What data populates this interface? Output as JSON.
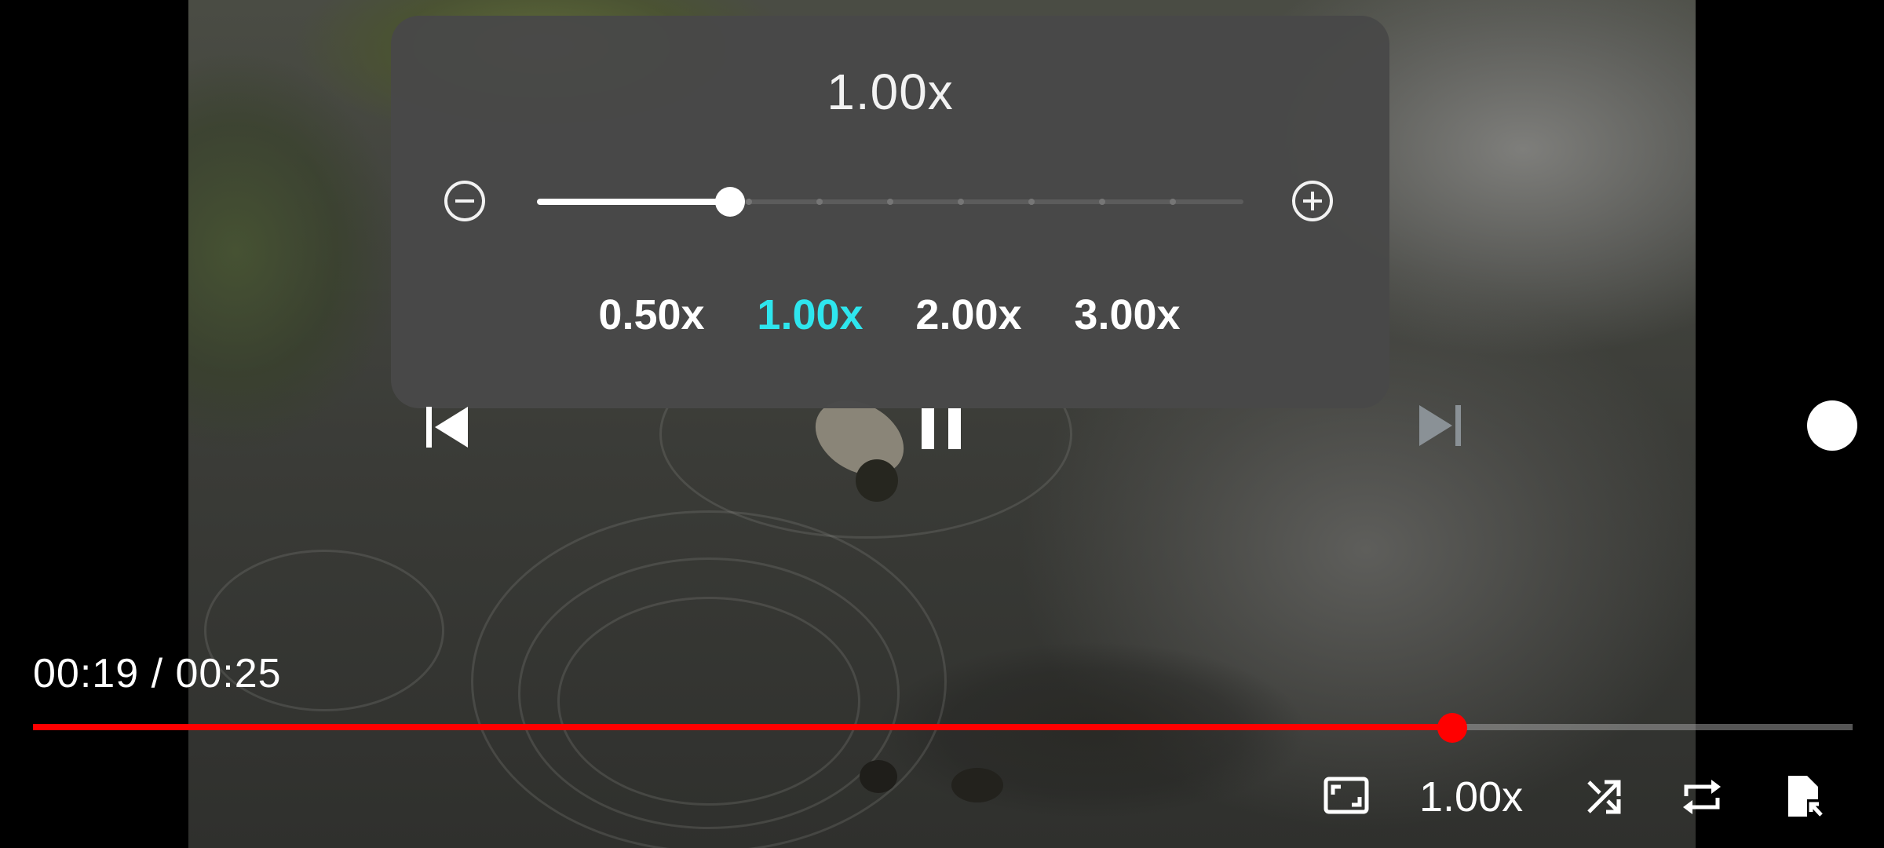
{
  "speed_panel": {
    "current_speed": "1.00x",
    "slider_level": 0.273,
    "slider_tick_count": 11,
    "decrease_icon": "minus-circle-icon",
    "increase_icon": "plus-circle-icon",
    "presets": [
      {
        "label": "0.50x",
        "active": false
      },
      {
        "label": "1.00x",
        "active": true
      },
      {
        "label": "2.00x",
        "active": false
      },
      {
        "label": "3.00x",
        "active": true
      }
    ],
    "active_color": "#2ee6ee"
  },
  "transport": {
    "previous_icon": "skip-previous-icon",
    "pause_icon": "pause-icon",
    "next_icon": "skip-next-icon"
  },
  "playback": {
    "time": "00:19 / 00:25",
    "progress": 0.78,
    "progress_color": "#ff0000",
    "speed_label": "1.00x"
  },
  "bottom_toolbar": {
    "icons": [
      "aspect-ratio-icon",
      "shuffle-icon",
      "repeat-icon",
      "file-info-icon"
    ]
  }
}
